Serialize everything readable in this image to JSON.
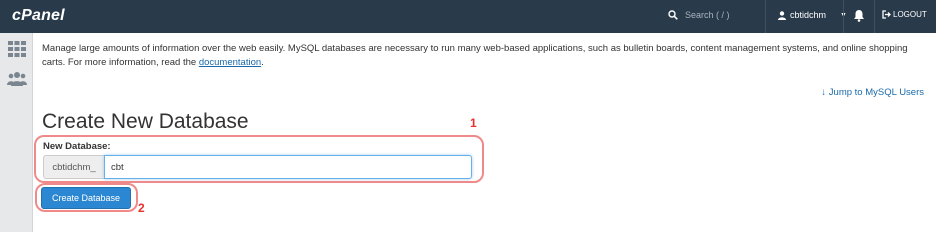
{
  "topbar": {
    "logo": "cPanel",
    "search_placeholder": "Search ( / )",
    "username": "cbtidchm",
    "logout_label": "LOGOUT"
  },
  "sidebar": {
    "items": [
      {
        "icon": "grid-icon"
      },
      {
        "icon": "users-icon"
      }
    ]
  },
  "main": {
    "intro_text": "Manage large amounts of information over the web easily. MySQL databases are necessary to run many web-based applications, such as bulletin boards, content management systems, and online shopping carts. For more information, read the ",
    "intro_link": "documentation",
    "intro_end": ".",
    "jump_link": "↓ Jump to MySQL Users",
    "title": "Create New Database",
    "field_label": "New Database:",
    "prefix": "cbtidchm_",
    "input_value": "cbt",
    "button_label": "Create Database"
  },
  "annotations": {
    "label_1": "1",
    "label_2": "2",
    "color": "#e8312c"
  },
  "colors": {
    "topbar": "#293a4a",
    "accent": "#2c87d3",
    "link": "#1a6aa9"
  }
}
